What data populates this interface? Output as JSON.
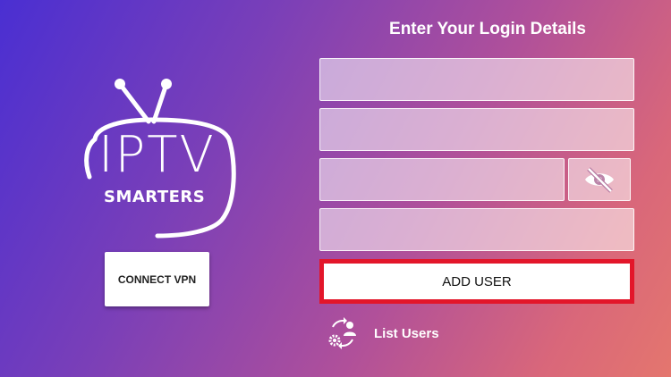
{
  "logo": {
    "line1": "IPTV",
    "line2": "SMARTERS"
  },
  "vpn": {
    "label": "CONNECT VPN"
  },
  "form": {
    "title": "Enter Your Login Details",
    "fields": {
      "username_placeholder": "",
      "password_placeholder": "",
      "password_confirm_placeholder": "",
      "url_placeholder": ""
    },
    "visibility_toggle_icon": "eye-slash-icon",
    "add_user_label": "ADD USER",
    "list_users_label": "List Users",
    "list_users_icon": "users-refresh-icon"
  },
  "colors": {
    "highlight_border": "#e3162a",
    "gradient_start": "#4a2fd2",
    "gradient_end": "#e4766e"
  }
}
